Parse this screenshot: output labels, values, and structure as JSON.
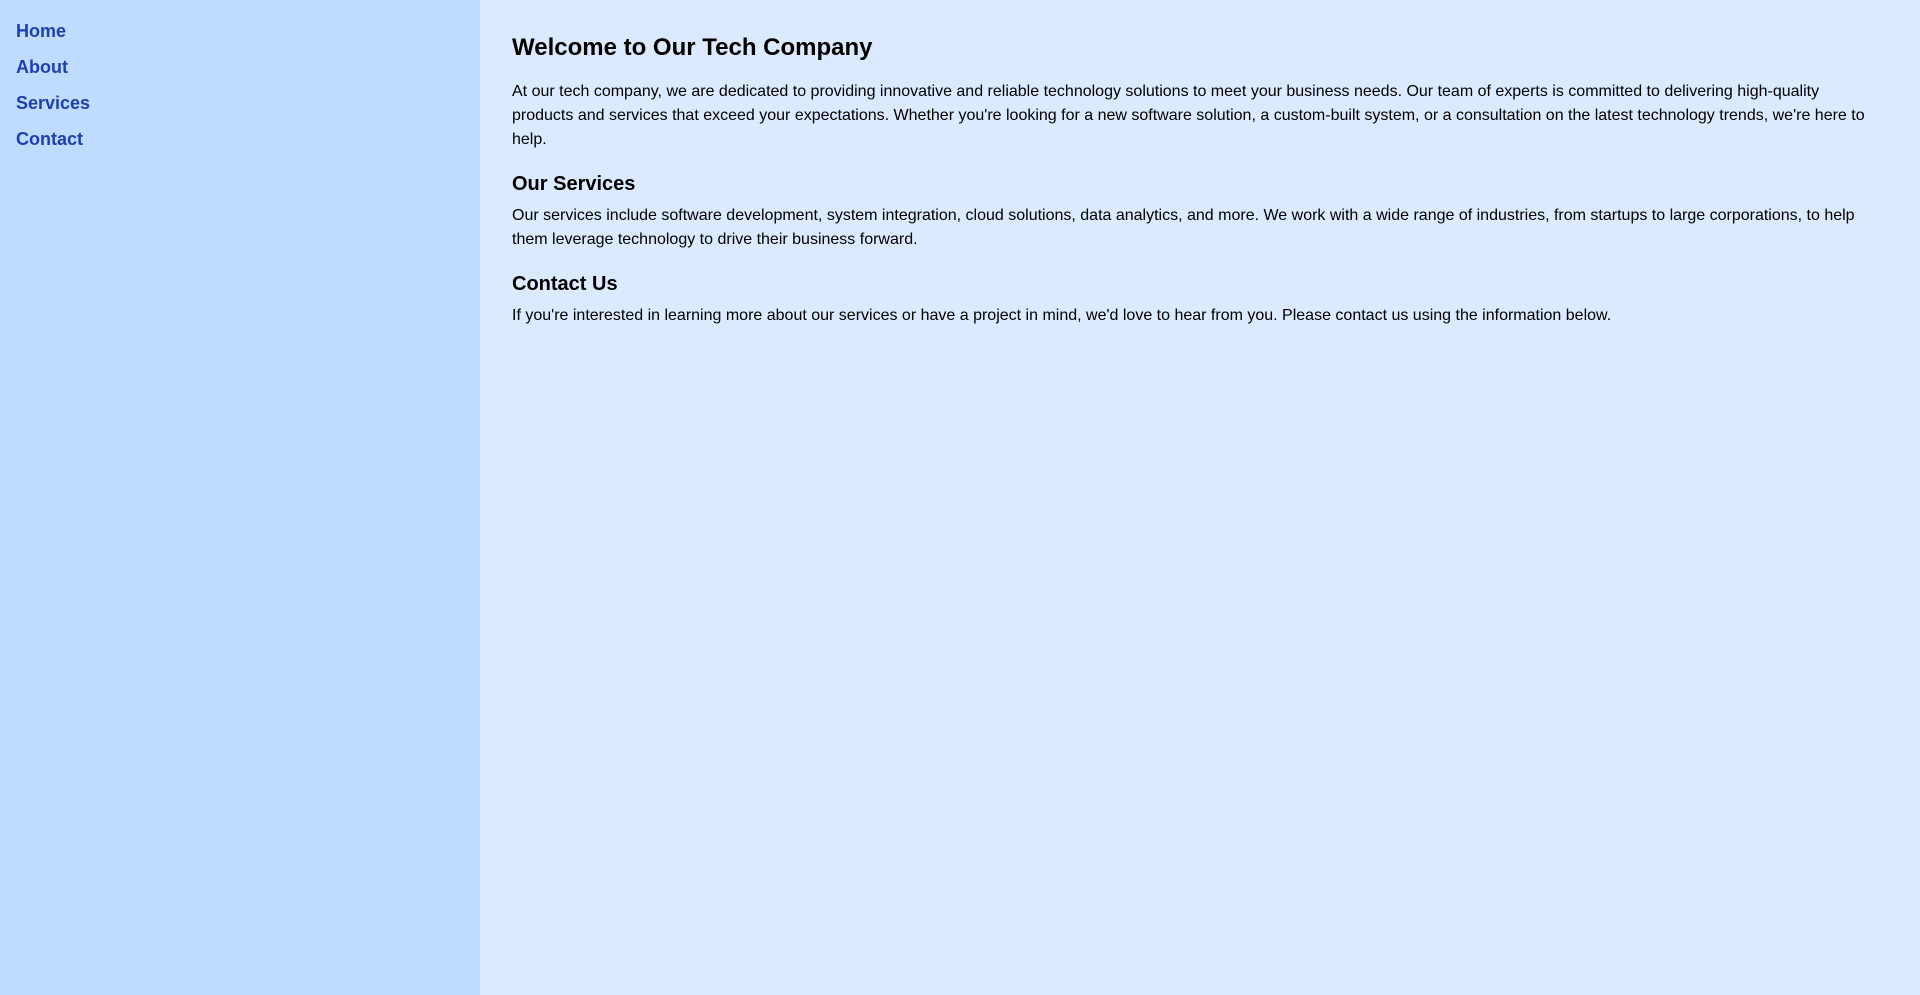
{
  "sidebar": {
    "items": [
      {
        "label": "Home"
      },
      {
        "label": "About"
      },
      {
        "label": "Services"
      },
      {
        "label": "Contact"
      }
    ]
  },
  "main": {
    "title": "Welcome to Our Tech Company",
    "intro": "At our tech company, we are dedicated to providing innovative and reliable technology solutions to meet your business needs. Our team of experts is committed to delivering high-quality products and services that exceed your expectations. Whether you're looking for a new software solution, a custom-built system, or a consultation on the latest technology trends, we're here to help.",
    "sections": [
      {
        "heading": "Our Services",
        "body": "Our services include software development, system integration, cloud solutions, data analytics, and more. We work with a wide range of industries, from startups to large corporations, to help them leverage technology to drive their business forward."
      },
      {
        "heading": "Contact Us",
        "body": "If you're interested in learning more about our services or have a project in mind, we'd love to hear from you. Please contact us using the information below."
      }
    ]
  },
  "colors": {
    "sidebar_bg": "#bfdbfe",
    "main_bg": "#dbeafe",
    "nav_link": "#1e40af",
    "text": "#000000"
  }
}
